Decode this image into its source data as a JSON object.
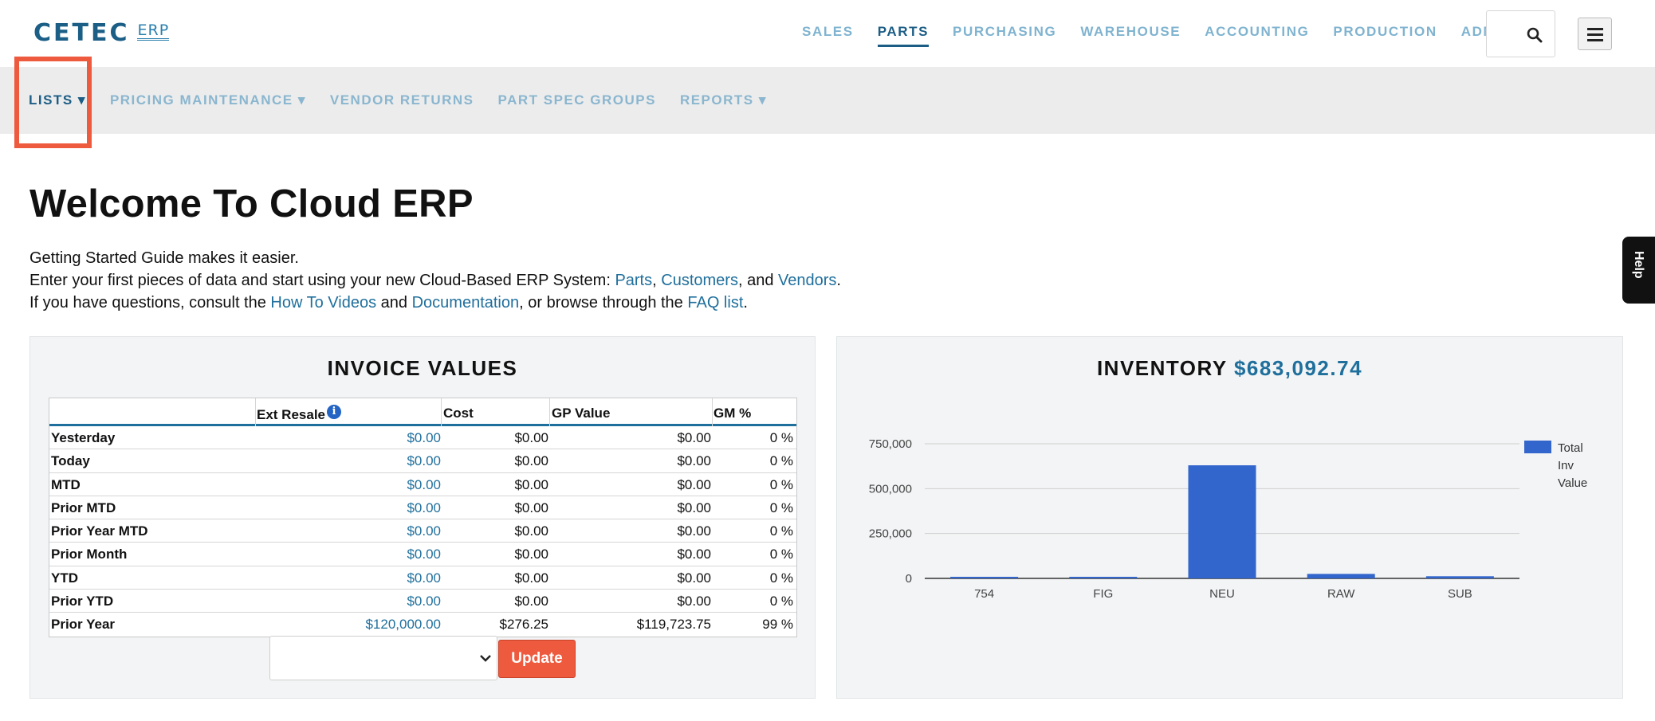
{
  "header": {
    "logo_main": "CETEC",
    "logo_sub": "ERP",
    "nav": [
      {
        "label": "SALES",
        "active": false
      },
      {
        "label": "PARTS",
        "active": true
      },
      {
        "label": "PURCHASING",
        "active": false
      },
      {
        "label": "WAREHOUSE",
        "active": false
      },
      {
        "label": "ACCOUNTING",
        "active": false
      },
      {
        "label": "PRODUCTION",
        "active": false
      },
      {
        "label": "ADMIN",
        "active": false
      }
    ],
    "search_icon": "search-icon",
    "menu_icon": "hamburger-menu-icon"
  },
  "subnav": {
    "items": [
      {
        "label": "LISTS ▾",
        "active": true
      },
      {
        "label": "PRICING MAINTENANCE ▾",
        "active": false
      },
      {
        "label": "VENDOR RETURNS",
        "active": false
      },
      {
        "label": "PART SPEC GROUPS",
        "active": false
      },
      {
        "label": "REPORTS ▾",
        "active": false
      }
    ]
  },
  "welcome": {
    "title": "Welcome To Cloud ERP",
    "line1": "Getting Started Guide makes it easier.",
    "line2_prefix": "Enter your first pieces of data and start using your new Cloud-Based ERP System: ",
    "link_parts": "Parts",
    "sep1": ", ",
    "link_customers": "Customers",
    "sep2": ", and ",
    "link_vendors": "Vendors",
    "line2_end": ".",
    "line3_prefix": "If you have questions, consult the ",
    "link_videos": "How To Videos",
    "sep3": " and ",
    "link_docs": "Documentation",
    "sep4": ", or browse through the ",
    "link_faq": "FAQ list",
    "line3_end": "."
  },
  "help_tab": "Help",
  "invoice": {
    "title": "INVOICE VALUES",
    "columns": [
      "Ext Resale",
      "Cost",
      "GP Value",
      "GM %"
    ],
    "info_icon": "info-icon",
    "rows": [
      {
        "label": "Yesterday",
        "ext": "$0.00",
        "cost": "$0.00",
        "gp": "$0.00",
        "gm": "0 %"
      },
      {
        "label": "Today",
        "ext": "$0.00",
        "cost": "$0.00",
        "gp": "$0.00",
        "gm": "0 %"
      },
      {
        "label": "MTD",
        "ext": "$0.00",
        "cost": "$0.00",
        "gp": "$0.00",
        "gm": "0 %"
      },
      {
        "label": "Prior MTD",
        "ext": "$0.00",
        "cost": "$0.00",
        "gp": "$0.00",
        "gm": "0 %"
      },
      {
        "label": "Prior Year MTD",
        "ext": "$0.00",
        "cost": "$0.00",
        "gp": "$0.00",
        "gm": "0 %"
      },
      {
        "label": "Prior Month",
        "ext": "$0.00",
        "cost": "$0.00",
        "gp": "$0.00",
        "gm": "0 %"
      },
      {
        "label": "YTD",
        "ext": "$0.00",
        "cost": "$0.00",
        "gp": "$0.00",
        "gm": "0 %"
      },
      {
        "label": "Prior YTD",
        "ext": "$0.00",
        "cost": "$0.00",
        "gp": "$0.00",
        "gm": "0 %"
      },
      {
        "label": "Prior Year",
        "ext": "$120,000.00",
        "cost": "$276.25",
        "gp": "$119,723.75",
        "gm": "99 %"
      }
    ],
    "select_value": "",
    "update_label": "Update"
  },
  "inventory": {
    "title": "INVENTORY",
    "total": "$683,092.74"
  },
  "chart_data": {
    "type": "bar",
    "categories": [
      "754",
      "FIG",
      "NEU",
      "RAW",
      "SUB"
    ],
    "series": [
      {
        "name": "Total Inv Value",
        "values": [
          1500,
          500,
          630000,
          25000,
          12000
        ]
      }
    ],
    "legend_lines": [
      "Total",
      "Inv",
      "Value"
    ],
    "yticks": [
      "0",
      "250,000",
      "500,000",
      "750,000"
    ],
    "ytick_values": [
      0,
      250000,
      500000,
      750000
    ],
    "ylim": [
      0,
      750000
    ],
    "grid": true,
    "legend_position": "right",
    "bar_color": "#3366cc"
  }
}
